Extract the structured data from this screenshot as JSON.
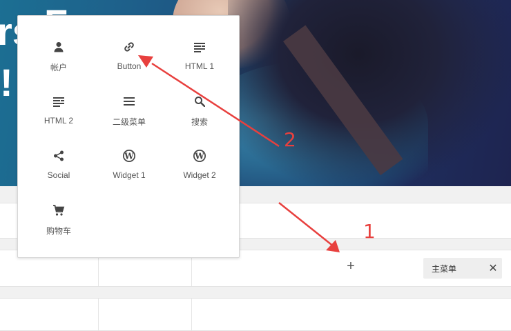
{
  "hero": {
    "text_fragments": [
      "rs",
      "F",
      "!"
    ]
  },
  "panel": {
    "items": [
      {
        "label": "帐户",
        "icon": "person-icon"
      },
      {
        "label": "Button",
        "icon": "link-icon"
      },
      {
        "label": "HTML 1",
        "icon": "text-lines-icon"
      },
      {
        "label": "HTML 2",
        "icon": "text-lines-icon"
      },
      {
        "label": "二级菜单",
        "icon": "hamburger-menu-icon"
      },
      {
        "label": "搜索",
        "icon": "search-icon"
      },
      {
        "label": "Social",
        "icon": "share-icon"
      },
      {
        "label": "Widget 1",
        "icon": "wordpress-icon"
      },
      {
        "label": "Widget 2",
        "icon": "wordpress-icon"
      },
      {
        "label": "购物车",
        "icon": "cart-icon"
      }
    ]
  },
  "builder": {
    "add_symbol": "+",
    "menu_chip": {
      "label": "主菜单",
      "close_symbol": "✕"
    }
  },
  "annotations": {
    "marker_1": "1",
    "marker_2": "2",
    "color": "#e8403e"
  }
}
